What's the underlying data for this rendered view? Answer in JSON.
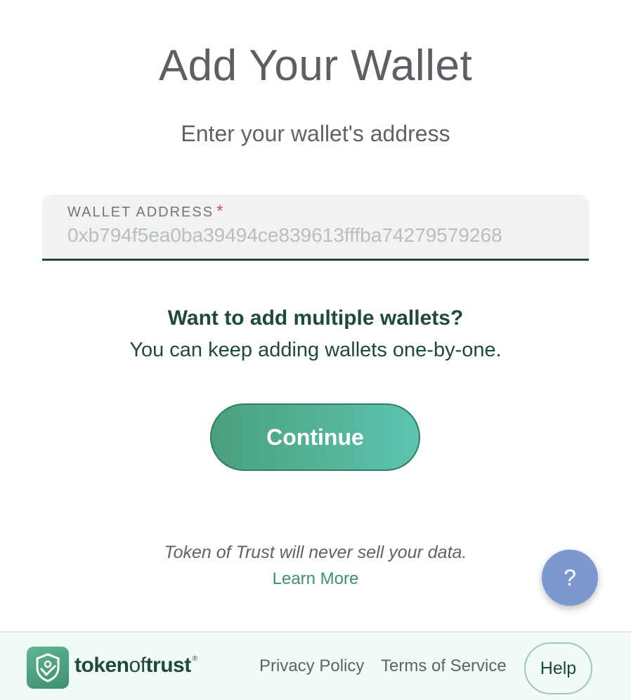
{
  "heading": {
    "title": "Add Your Wallet",
    "subtitle": "Enter your wallet's address"
  },
  "wallet_field": {
    "label": "WALLET ADDRESS",
    "required_mark": "*",
    "placeholder": "0xb794f5ea0ba39494ce839613fffba74279579268"
  },
  "multi_wallet": {
    "heading": "Want to add multiple wallets?",
    "text": "You can keep adding wallets one-by-one."
  },
  "continue_label": "Continue",
  "privacy": {
    "note": "Token of Trust will never sell your data.",
    "learn_more": "Learn More"
  },
  "help_fab": {
    "label": "?",
    "color": "#7b98cf"
  },
  "footer": {
    "brand_token": "token",
    "brand_of": "of",
    "brand_trust": "trust",
    "brand_reg": "®",
    "privacy_policy": "Privacy Policy",
    "terms_of_service": "Terms of Service",
    "help": "Help"
  },
  "colors": {
    "accent_dark": "#1f4a3a",
    "button_start": "#4aa07c",
    "button_end": "#5cc4af",
    "link": "#3f8f74"
  }
}
